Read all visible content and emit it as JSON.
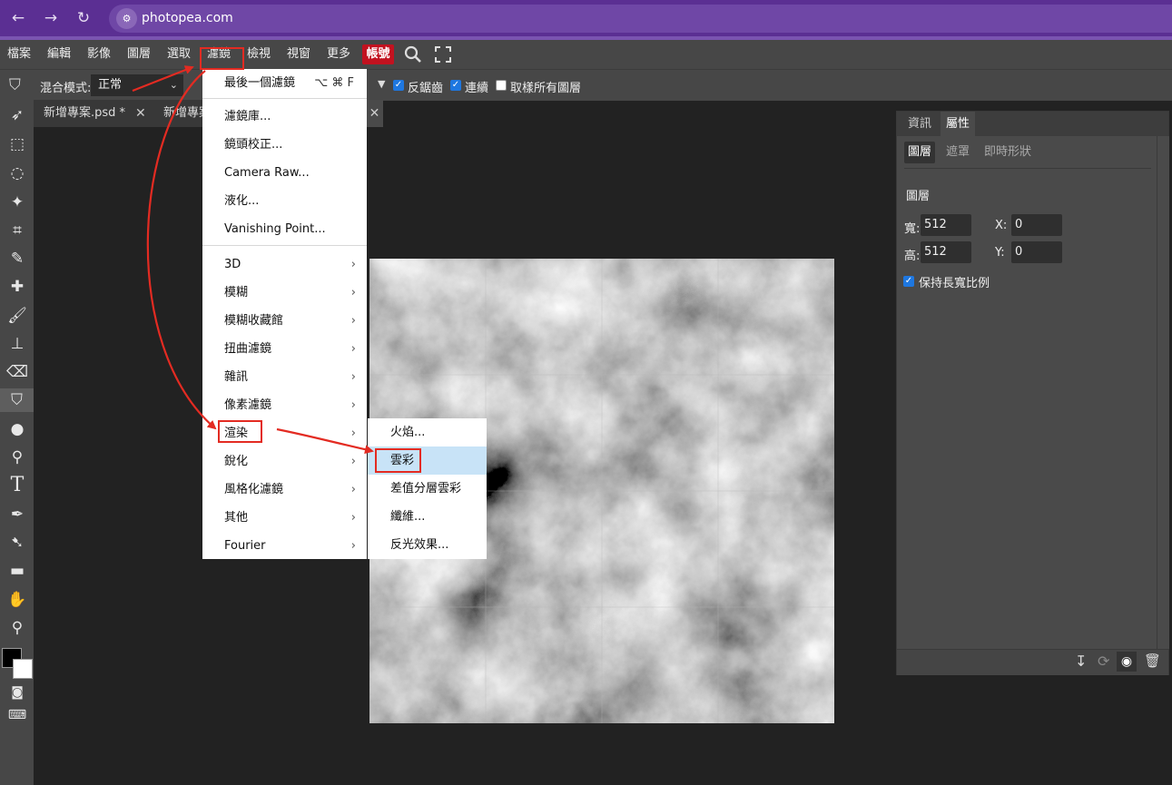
{
  "browser": {
    "url": "photopea.com",
    "site_icon": "⚙"
  },
  "menubar": {
    "items": [
      "檔案",
      "編輯",
      "影像",
      "圖層",
      "選取",
      "濾鏡",
      "檢視",
      "視窗",
      "更多"
    ],
    "account": "帳號"
  },
  "options": {
    "blend_label": "混合模式:",
    "blend_value": "正常",
    "antialias": "反鋸齒",
    "contiguous": "連續",
    "sample_all": "取樣所有圖層"
  },
  "tabs": [
    {
      "label": "新增專案.psd *",
      "close": "✕"
    },
    {
      "label": "新增專案",
      "close": "✕"
    }
  ],
  "filter_menu": {
    "last_filter": "最後一個濾鏡",
    "last_filter_shortcut": "⌥ ⌘ F",
    "group2": [
      "濾鏡庫...",
      "鏡頭校正...",
      "Camera Raw...",
      "液化...",
      "Vanishing Point..."
    ],
    "submenus": [
      "3D",
      "模糊",
      "模糊收藏館",
      "扭曲濾鏡",
      "雜訊",
      "像素濾鏡",
      "渲染",
      "銳化",
      "風格化濾鏡",
      "其他",
      "Fourier"
    ],
    "submenu_arrow": "›"
  },
  "render_menu": {
    "items": [
      "火焰...",
      "雲彩",
      "差值分層雲彩",
      "纖維...",
      "反光效果..."
    ],
    "highlighted": "雲彩"
  },
  "panel": {
    "tabs": [
      "資訊",
      "屬性"
    ],
    "active_tab": "屬性",
    "subtabs": [
      "圖層",
      "遮罩",
      "即時形狀"
    ],
    "section_title": "圖層",
    "width_label": "寬:",
    "width_value": "512",
    "height_label": "高:",
    "height_value": "512",
    "x_label": "X:",
    "x_value": "0",
    "y_label": "Y:",
    "y_value": "0",
    "keep_ratio": "保持長寬比例"
  },
  "colors": {
    "browser_bar": "#5b2f93",
    "account_red": "#c2121f",
    "annotation_red": "#e32b22",
    "highlight_blue": "#c8e3f7",
    "checkbox_blue": "#1e77e0"
  }
}
